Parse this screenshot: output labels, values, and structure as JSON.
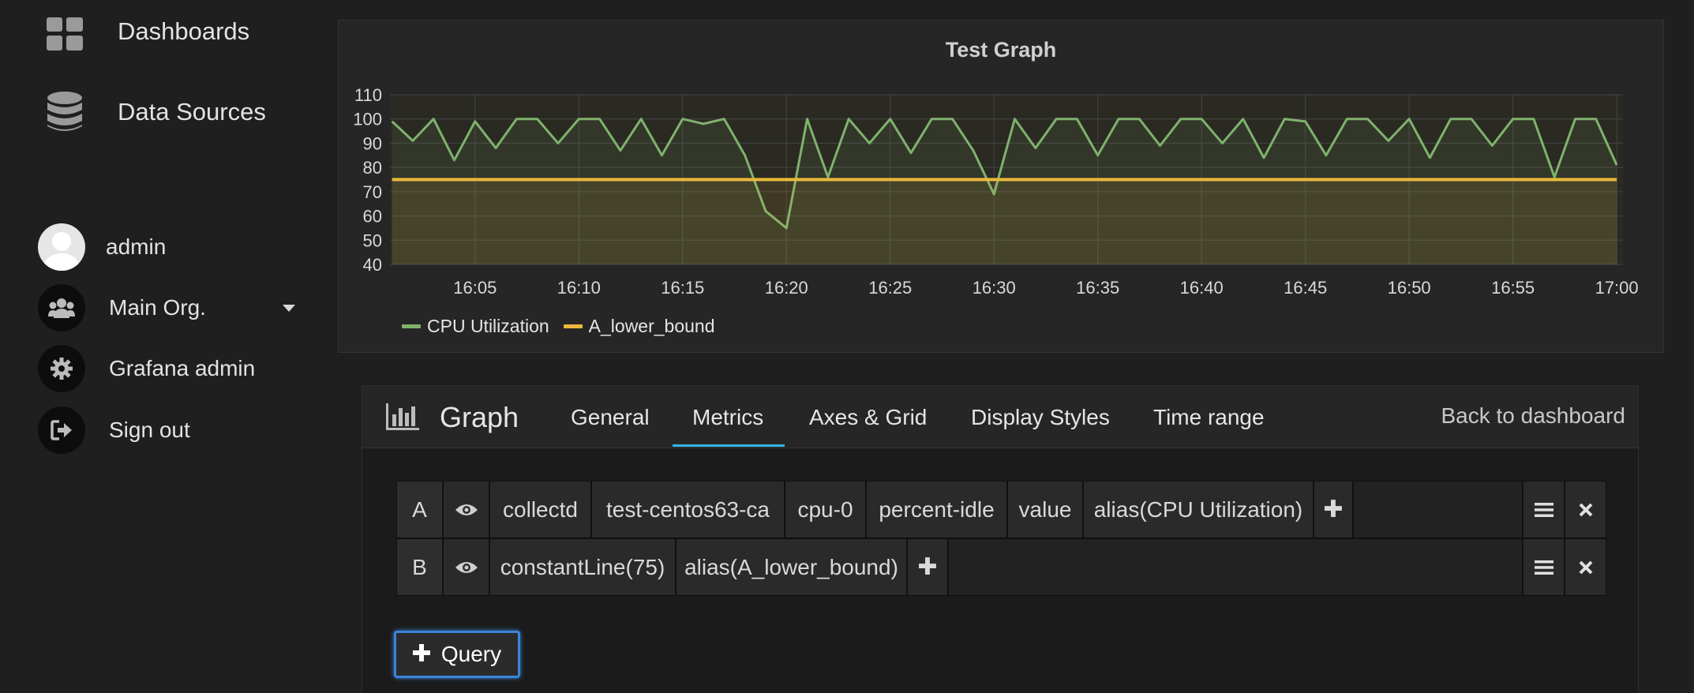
{
  "sidebar": {
    "nav": [
      {
        "label": "Dashboards",
        "icon": "dashboards-grid-icon"
      },
      {
        "label": "Data Sources",
        "icon": "database-icon"
      }
    ],
    "user": {
      "name": "admin",
      "org": "Main Org.",
      "grafana_admin": "Grafana admin",
      "sign_out": "Sign out"
    }
  },
  "panel": {
    "title": "Test Graph",
    "legend": [
      {
        "name": "CPU Utilization",
        "color": "#7eb26d"
      },
      {
        "name": "A_lower_bound",
        "color": "#eab839"
      }
    ]
  },
  "chart_data": {
    "type": "line",
    "title": "Test Graph",
    "xlabel": "",
    "ylabel": "",
    "ylim": [
      40,
      110
    ],
    "yticks": [
      40,
      50,
      60,
      70,
      80,
      90,
      100,
      110
    ],
    "x_range": [
      "16:01",
      "17:00"
    ],
    "xticks": [
      "16:05",
      "16:10",
      "16:15",
      "16:20",
      "16:25",
      "16:30",
      "16:35",
      "16:40",
      "16:45",
      "16:50",
      "16:55",
      "17:00"
    ],
    "grid": true,
    "legend_position": "bottom-left",
    "series": [
      {
        "name": "CPU Utilization",
        "color": "#7eb26d",
        "x": [
          "16:01",
          "16:02",
          "16:03",
          "16:04",
          "16:05",
          "16:06",
          "16:07",
          "16:08",
          "16:09",
          "16:10",
          "16:11",
          "16:12",
          "16:13",
          "16:14",
          "16:15",
          "16:16",
          "16:17",
          "16:18",
          "16:19",
          "16:20",
          "16:21",
          "16:22",
          "16:23",
          "16:24",
          "16:25",
          "16:26",
          "16:27",
          "16:28",
          "16:29",
          "16:30",
          "16:31",
          "16:32",
          "16:33",
          "16:34",
          "16:35",
          "16:36",
          "16:37",
          "16:38",
          "16:39",
          "16:40",
          "16:41",
          "16:42",
          "16:43",
          "16:44",
          "16:45",
          "16:46",
          "16:47",
          "16:48",
          "16:49",
          "16:50",
          "16:51",
          "16:52",
          "16:53",
          "16:54",
          "16:55",
          "16:56",
          "16:57",
          "16:58",
          "16:59",
          "17:00"
        ],
        "values": [
          99,
          91,
          100,
          83,
          99,
          88,
          100,
          100,
          90,
          100,
          100,
          87,
          100,
          85,
          100,
          98,
          100,
          85,
          62,
          55,
          100,
          76,
          100,
          90,
          100,
          86,
          100,
          100,
          87,
          69,
          100,
          88,
          100,
          100,
          85,
          100,
          100,
          89,
          100,
          100,
          90,
          100,
          84,
          100,
          99,
          85,
          100,
          100,
          91,
          100,
          84,
          100,
          100,
          89,
          100,
          100,
          76,
          100,
          100,
          81
        ]
      },
      {
        "name": "A_lower_bound",
        "color": "#eab839",
        "x": [
          "16:01",
          "17:00"
        ],
        "values": [
          75,
          75
        ]
      }
    ]
  },
  "editor": {
    "title": "Graph",
    "tabs": [
      "General",
      "Metrics",
      "Axes & Grid",
      "Display Styles",
      "Time range"
    ],
    "active_tab": "Metrics",
    "back_label": "Back to dashboard",
    "queries": [
      {
        "letter": "A",
        "segments": [
          "collectd",
          "test-centos63-ca",
          "cpu-0",
          "percent-idle",
          "value",
          "alias(CPU Utilization)"
        ]
      },
      {
        "letter": "B",
        "segments": [
          "constantLine(75)",
          "alias(A_lower_bound)"
        ]
      }
    ],
    "add_query_label": "Query"
  }
}
